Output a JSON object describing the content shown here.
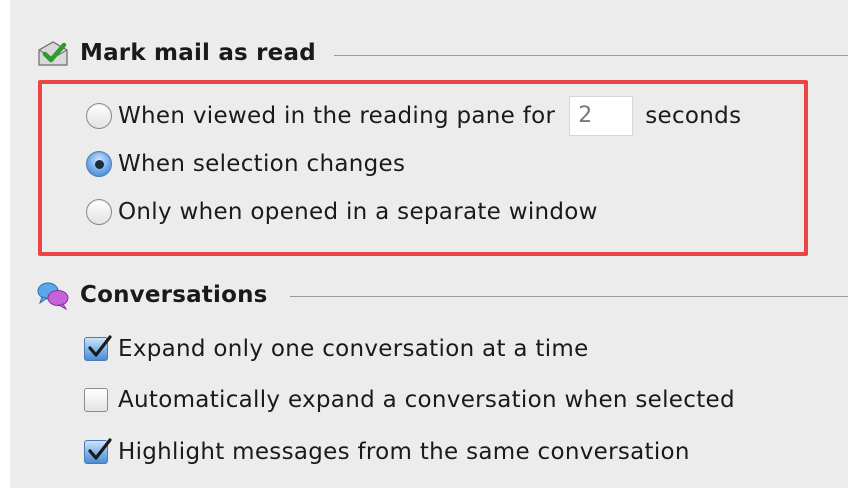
{
  "mark_read": {
    "title": "Mark mail as read",
    "icon": "checked-envelope-icon",
    "options": [
      {
        "label_before": "When viewed in the reading pane for",
        "seconds_value": "2",
        "label_after": "seconds",
        "selected": false
      },
      {
        "label": "When selection changes",
        "selected": true
      },
      {
        "label": "Only when opened in a separate window",
        "selected": false
      }
    ]
  },
  "conversations": {
    "title": "Conversations",
    "icon": "speech-bubbles-icon",
    "options": [
      {
        "label": "Expand only one conversation at a time",
        "checked": true
      },
      {
        "label": "Automatically expand a conversation when selected",
        "checked": false
      },
      {
        "label": "Highlight messages from the same conversation",
        "checked": true
      }
    ]
  },
  "colors": {
    "panel_background": "#ececec",
    "highlight_border": "#ec4545",
    "accent_blue": "#5b93d6"
  }
}
